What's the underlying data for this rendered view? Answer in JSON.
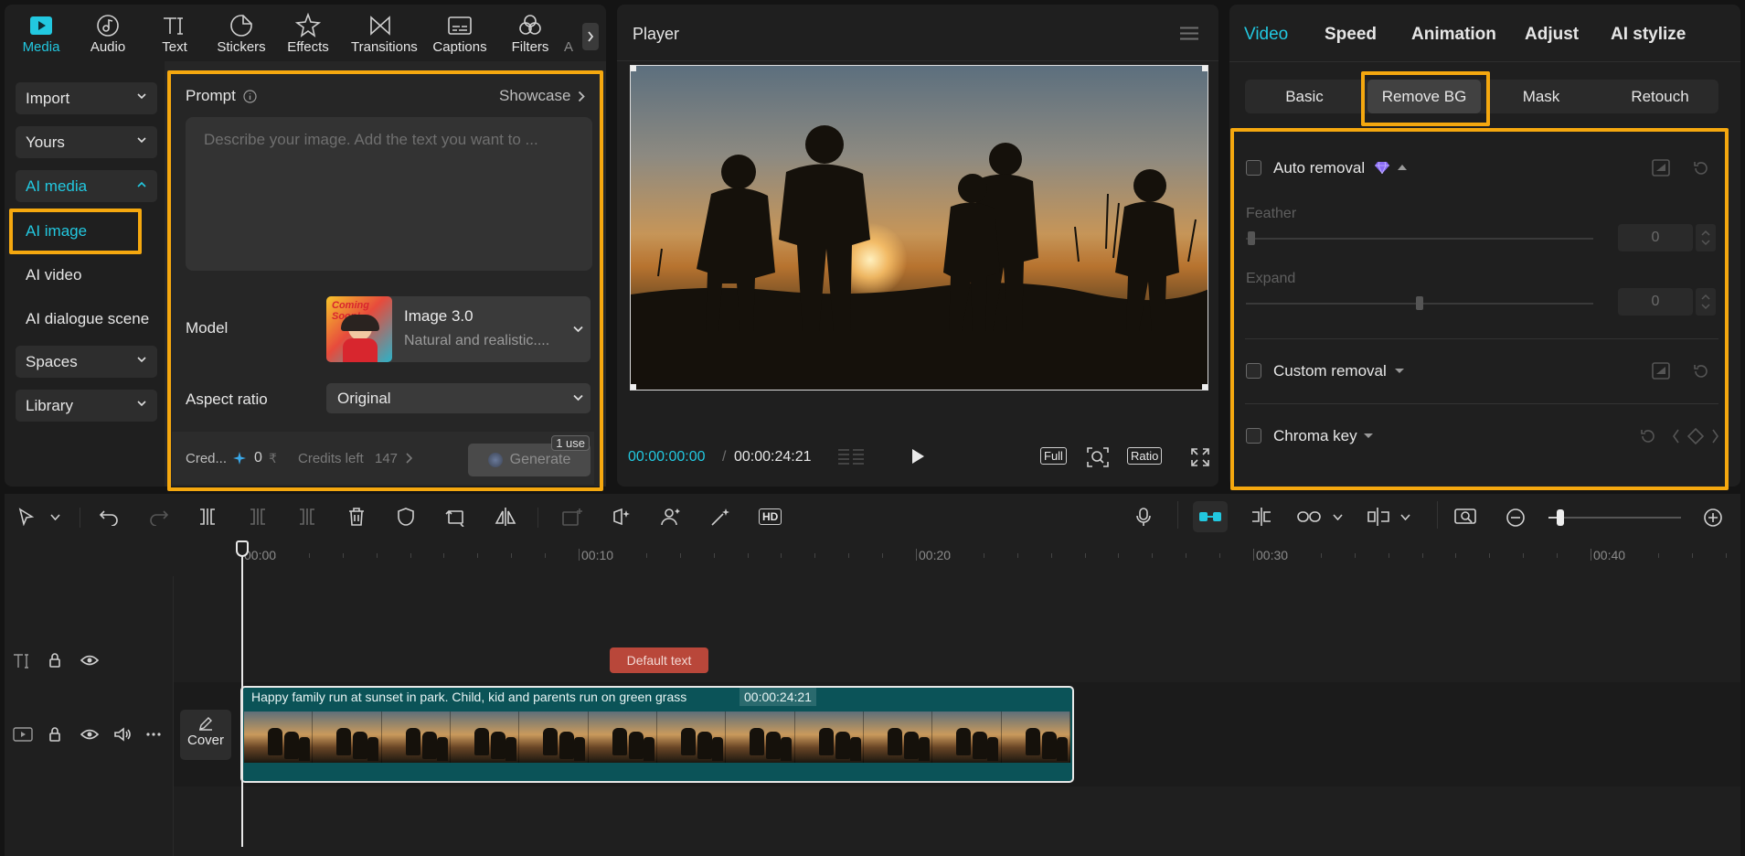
{
  "toolbar": {
    "items": [
      {
        "label": "Media",
        "icon": "media-icon"
      },
      {
        "label": "Audio",
        "icon": "audio-icon"
      },
      {
        "label": "Text",
        "icon": "text-icon"
      },
      {
        "label": "Stickers",
        "icon": "stickers-icon"
      },
      {
        "label": "Effects",
        "icon": "effects-icon"
      },
      {
        "label": "Transitions",
        "icon": "transitions-icon"
      },
      {
        "label": "Captions",
        "icon": "captions-icon"
      },
      {
        "label": "Filters",
        "icon": "filters-icon"
      },
      {
        "label": "A",
        "icon": "more-icon"
      }
    ]
  },
  "sidebar": {
    "import": "Import",
    "yours": "Yours",
    "ai_media": "AI media",
    "ai_image": "AI image",
    "ai_video": "AI video",
    "ai_dialogue": "AI dialogue scene",
    "spaces": "Spaces",
    "library": "Library"
  },
  "prompt": {
    "label": "Prompt",
    "showcase": "Showcase",
    "placeholder": "Describe your image. Add the text you want to ...",
    "model_label": "Model",
    "model_name": "Image 3.0",
    "model_desc": "Natural and realistic....",
    "thumb_text": "Coming Soon!",
    "aspect_label": "Aspect ratio",
    "aspect_value": "Original",
    "credits_label": "Cred...",
    "credits_value": "0",
    "credits_left": "Credits left",
    "credits_left_value": "147",
    "generate": "Generate",
    "use_badge": "1 use"
  },
  "player": {
    "title": "Player",
    "time_current": "00:00:00:00",
    "time_separator": "/",
    "time_total": "00:00:24:21",
    "btn_full": "Full",
    "btn_ratio": "Ratio"
  },
  "right_panel": {
    "tabs": [
      "Video",
      "Speed",
      "Animation",
      "Adjust",
      "AI stylize"
    ],
    "subtabs": [
      "Basic",
      "Remove BG",
      "Mask",
      "Retouch"
    ],
    "auto_removal": "Auto removal",
    "feather_label": "Feather",
    "feather_value": "0",
    "expand_label": "Expand",
    "expand_value": "0",
    "custom_removal": "Custom removal",
    "chroma_key": "Chroma key",
    "feather_level": 0,
    "expand_level": 0.49
  },
  "timeline": {
    "ruler": [
      "00:00",
      "00:10",
      "00:20",
      "00:30",
      "00:40"
    ],
    "text_clip": "Default text",
    "video_clip_title": "Happy family run at sunset in park. Child, kid and parents run on green grass",
    "video_clip_duration": "00:00:24:21",
    "cover_label": "Cover"
  },
  "colors": {
    "accent": "#22c8e0",
    "highlight": "#f5a80f",
    "clip": "#0b5358",
    "text_clip": "#b9473a"
  }
}
